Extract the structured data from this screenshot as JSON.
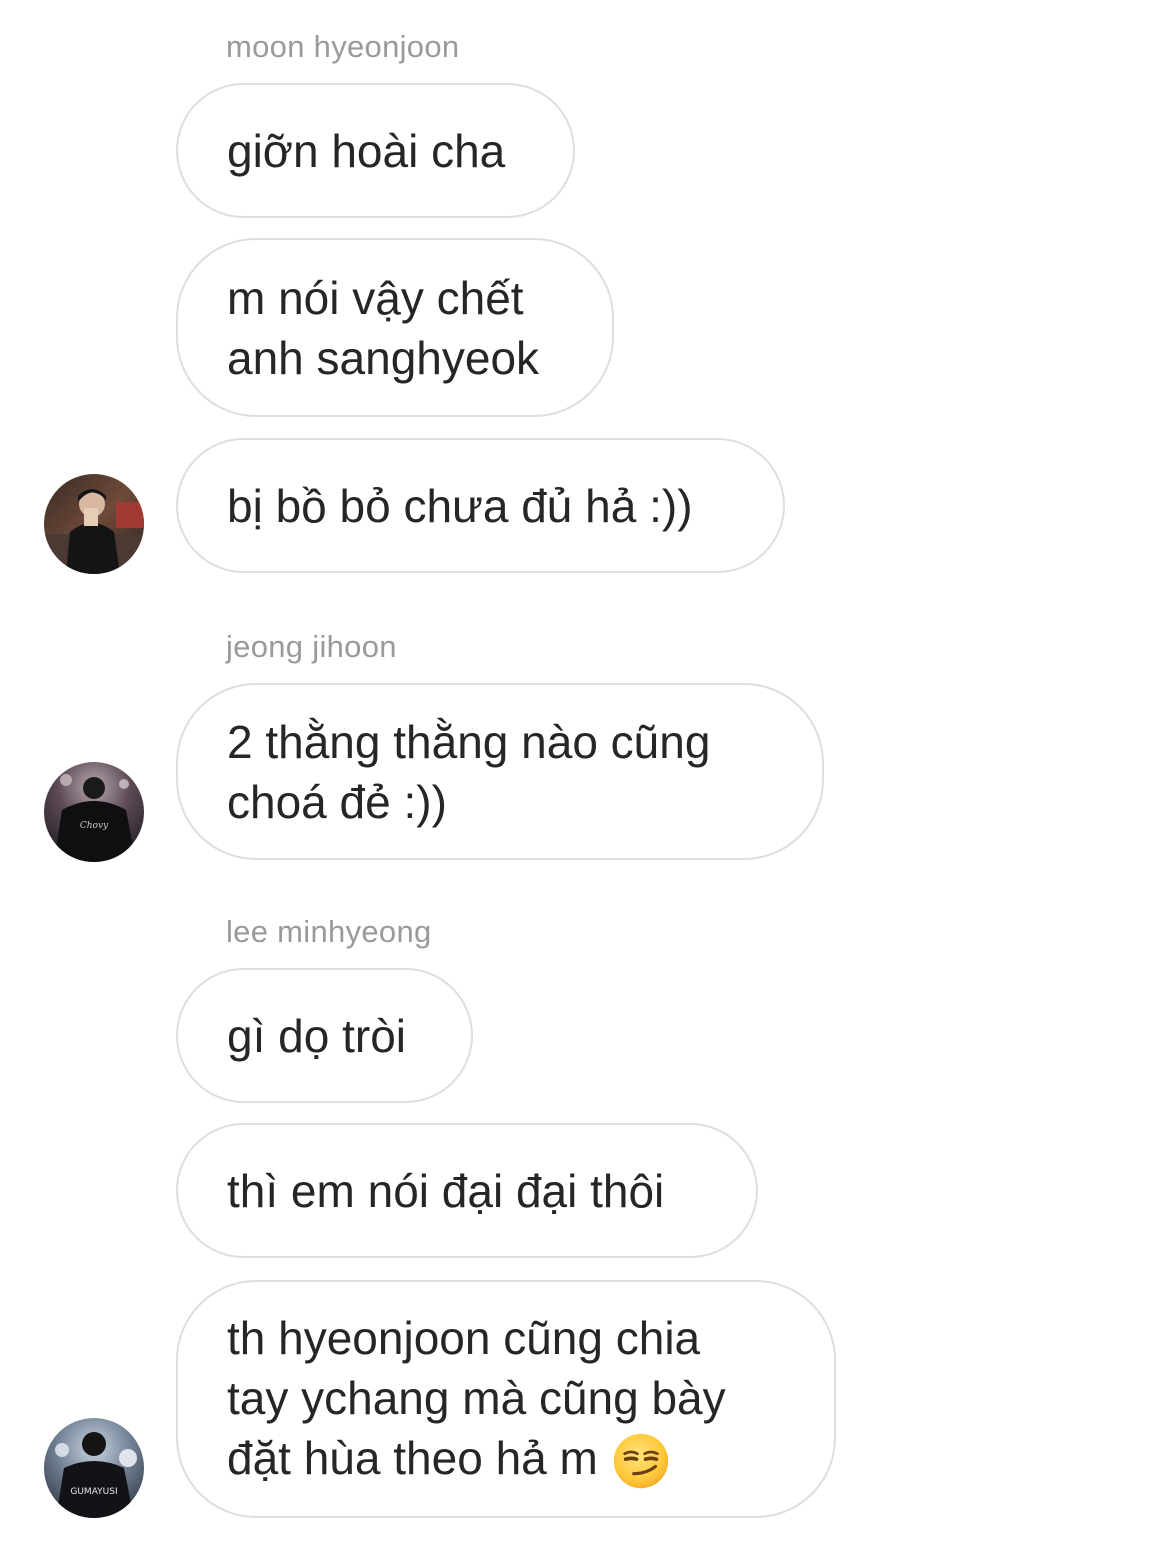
{
  "conversation": {
    "groups": [
      {
        "sender": "moon hyeonjoon",
        "messages": [
          "giỡn hoài cha",
          "m nói vậy chết\nanh sanghyeok",
          "bị bồ bỏ chưa đủ hả :))"
        ]
      },
      {
        "sender": "jeong jihoon",
        "messages": [
          "2 thằng thằng nào cũng\nchoá đẻ :))"
        ]
      },
      {
        "sender": "lee minhyeong",
        "messages": [
          "gì dọ tròi",
          "thì em nói đại đại thôi",
          "th hyeonjoon cũng chia\ntay ychang mà cũng bày\nđặt hùa theo hả m"
        ]
      }
    ],
    "avatar_badges": {
      "jihoon_shirt": "Chovy",
      "minhyeong_shirt": "GUMAYUSI"
    },
    "icons": {
      "smirk_emoji": "smirking-face-icon"
    },
    "colors": {
      "bubble_border": "#dedede",
      "sender_name": "#9a9a9a",
      "text": "#262626"
    }
  }
}
